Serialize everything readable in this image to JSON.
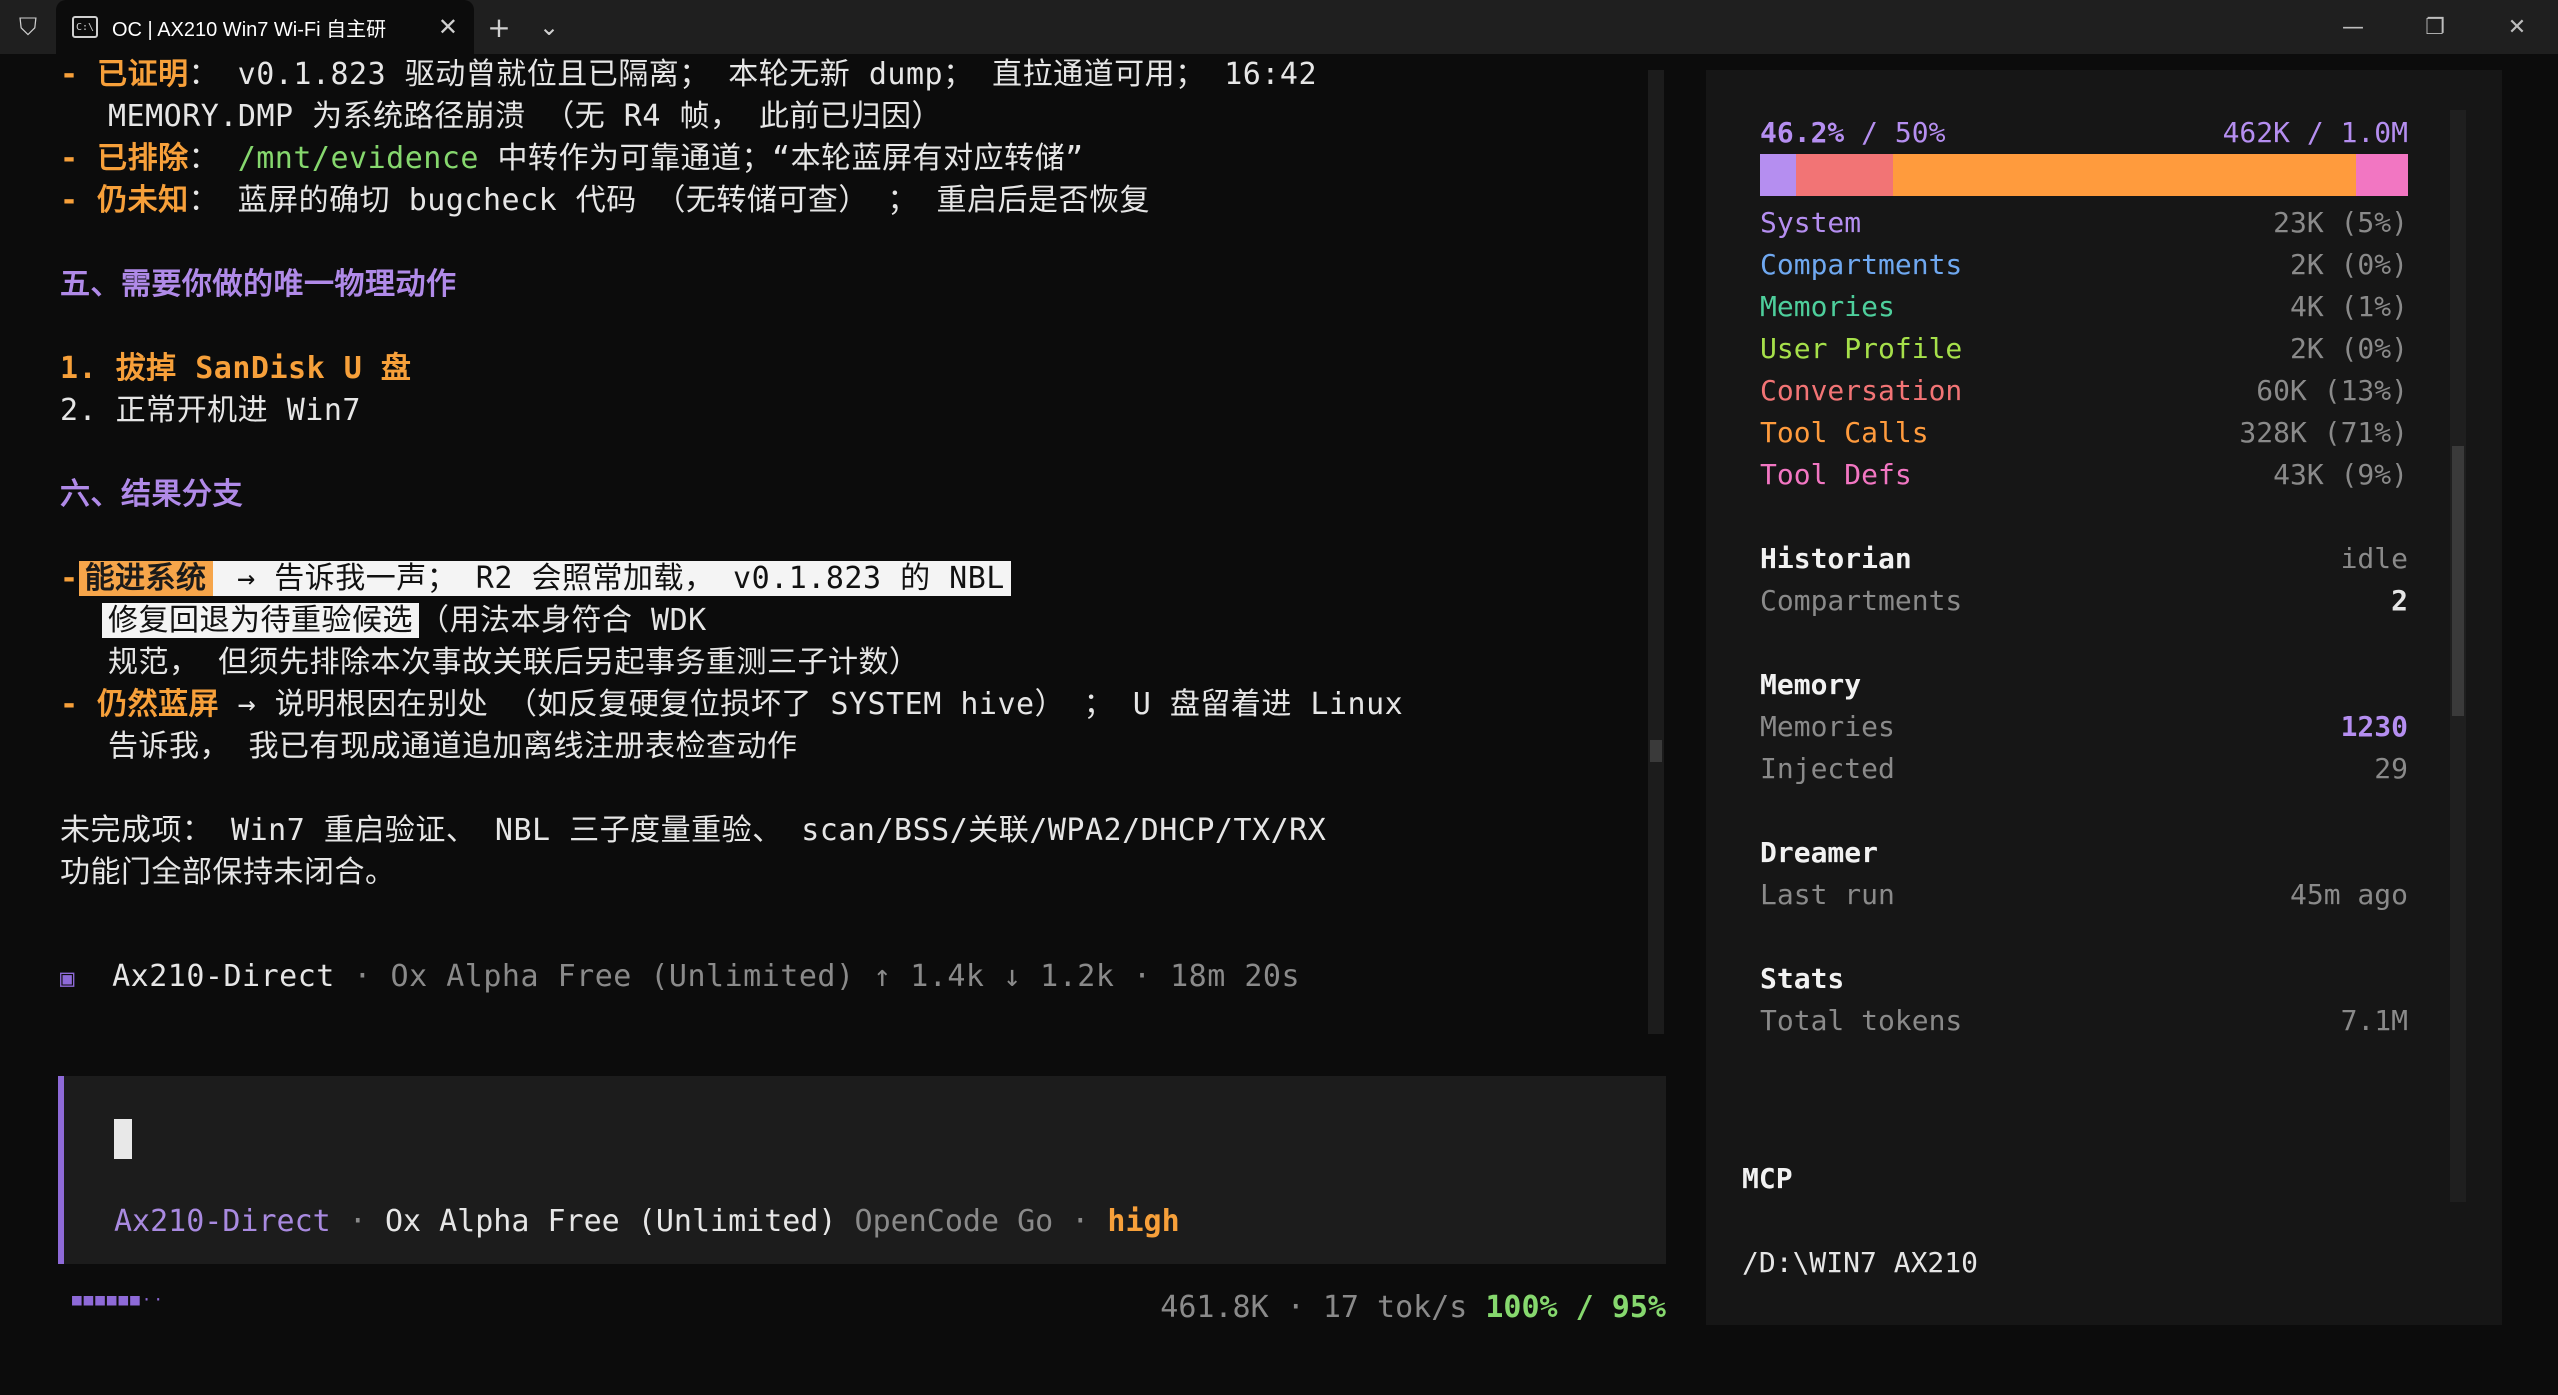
{
  "window": {
    "tab_title": "OC | AX210 Win7 Wi-Fi 自主研",
    "tab_icon_text": "C:\\",
    "new_tab": "+",
    "dropdown": "⌄",
    "close": "✕",
    "minimize": "—",
    "maximize": "❐",
    "window_close": "✕"
  },
  "terminal": {
    "l1_prefix": "- ",
    "l1_label": "已证明",
    "l1_text": "： v0.1.823 驱动曾就位且已隔离； 本轮无新 dump； 直拉通道可用； 16:42",
    "l2_text": "MEMORY.DMP 为系统路径崩溃 （无 R4 帧， 此前已归因）",
    "l3_label": "已排除",
    "l3_sep": "： ",
    "l3_path": "/mnt/evidence",
    "l3_text": " 中转作为可靠通道；“本轮蓝屏有对应转储”",
    "l4_label": "仍未知",
    "l4_text": "： 蓝屏的确切 bugcheck 代码 （无转储可查） ； 重启后是否恢复",
    "h5": "五、需要你做的唯一物理动作",
    "s1_num": "1. ",
    "s1_text": "拔掉 SanDisk U 盘",
    "s2": "2. 正常开机进 Win7",
    "h6": "六、结果分支",
    "b1_label": "能进系统",
    "b1_text": " → 告诉我一声； R2 会照常加载， v0.1.823 的 NBL",
    "b1_line2_hl": "修复回退为待重验候选",
    "b1_line2_rest": "（用法本身符合 WDK",
    "b1_line3": "规范， 但须先排除本次事故关联后另起事务重测三子计数）",
    "b2_label": "仍然蓝屏",
    "b2_text": " → 说明根因在别处 （如反复硬复位损坏了 SYSTEM hive） ； U 盘留着进 Linux",
    "b2_line2": "告诉我， 我已有现成通道追加离线注册表检查动作",
    "unfinished1": "未完成项： Win7 重启验证、 NBL 三子度量重验、 scan/BSS/关联/WPA2/DHCP/TX/RX",
    "unfinished2": "功能门全部保持未闭合。",
    "footer_icon": "▣",
    "footer_agent": "Ax210-Direct",
    "footer_rest": " · Ox Alpha Free (Unlimited) ↑ 1.4k ↓ 1.2k · 18m 20s"
  },
  "input": {
    "agent": "Ax210-Direct",
    "sep1": " · ",
    "model": "Ox Alpha Free (Unlimited)",
    "provider": " OpenCode Go",
    "sep2": " · ",
    "effort": "high"
  },
  "statusbar": {
    "dots": "■■■■■■··",
    "tokens": "461.8K · 17 tok/s ",
    "pct": "100% / 95%"
  },
  "panel": {
    "usage_pct": "46.2%",
    "usage_limit": " / 50%",
    "usage_tokens": "462K / 1.0M",
    "bar": [
      {
        "color": "#b58ef0",
        "frac": 0.055
      },
      {
        "color": "#f27475",
        "frac": 0.15
      },
      {
        "color": "#ff9b3d",
        "frac": 0.715
      },
      {
        "color": "#f276c2",
        "frac": 0.08
      }
    ],
    "rows": [
      {
        "label": "System",
        "value": "23K (5%)",
        "color": "#b58ef0"
      },
      {
        "label": "Compartments",
        "value": "2K (0%)",
        "color": "#6fa8f0"
      },
      {
        "label": "Memories",
        "value": "4K (1%)",
        "color": "#4ecf9c"
      },
      {
        "label": "User Profile",
        "value": "2K (0%)",
        "color": "#a6e04a"
      },
      {
        "label": "Conversation",
        "value": "60K (13%)",
        "color": "#f27475"
      },
      {
        "label": "Tool Calls",
        "value": "328K (71%)",
        "color": "#ff9b3d"
      },
      {
        "label": "Tool Defs",
        "value": "43K (9%)",
        "color": "#f276c2"
      }
    ],
    "historian": {
      "title": "Historian",
      "status": "idle",
      "label": "Compartments",
      "value": "2"
    },
    "memory": {
      "title": "Memory",
      "l1": "Memories",
      "v1": "1230",
      "l2": "Injected",
      "v2": "29"
    },
    "dreamer": {
      "title": "Dreamer",
      "label": "Last run",
      "value": "45m ago"
    },
    "stats": {
      "title": "Stats",
      "label": "Total tokens",
      "value": "7.1M"
    },
    "mcp": "MCP",
    "path": "/D:\\WIN7 AX210"
  }
}
